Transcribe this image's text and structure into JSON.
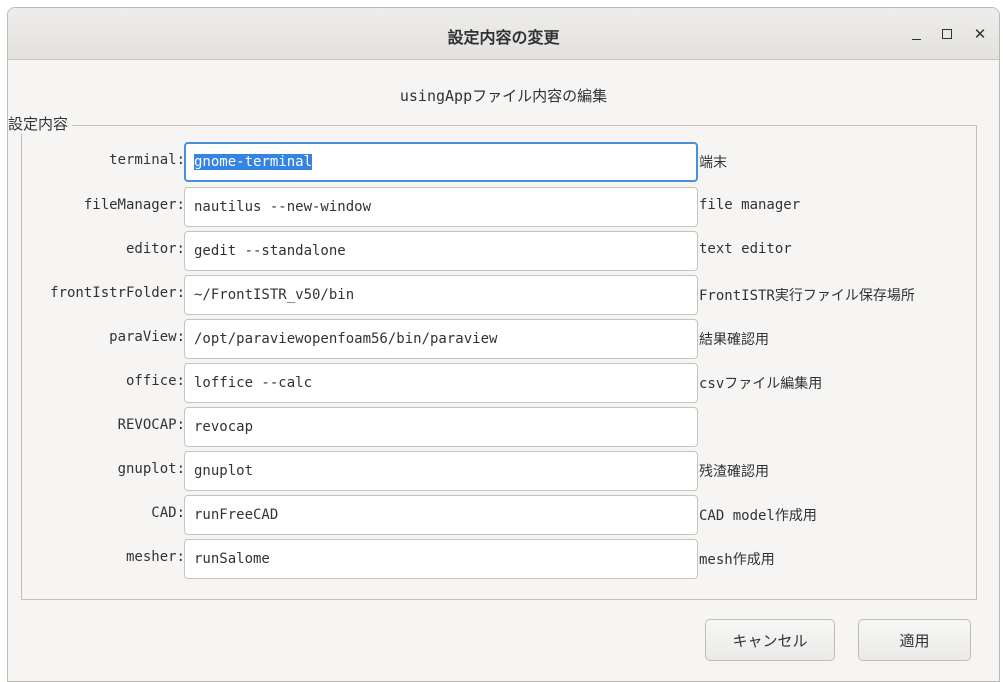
{
  "window": {
    "title": "設定内容の変更",
    "controls": {
      "minimize": "minimize-icon",
      "maximize": "maximize-icon",
      "close": "close-icon"
    }
  },
  "subtitle": "usingAppファイル内容の編集",
  "group": {
    "label": "設定内容"
  },
  "rows": [
    {
      "label": "terminal:",
      "value": "gnome-terminal",
      "desc": "端末"
    },
    {
      "label": "fileManager:",
      "value": "nautilus --new-window",
      "desc": "file manager"
    },
    {
      "label": "editor:",
      "value": "gedit --standalone",
      "desc": "text editor"
    },
    {
      "label": "frontIstrFolder:",
      "value": "~/FrontISTR_v50/bin",
      "desc": "FrontISTR実行ファイル保存場所"
    },
    {
      "label": "paraView:",
      "value": "/opt/paraviewopenfoam56/bin/paraview",
      "desc": "結果確認用"
    },
    {
      "label": "office:",
      "value": "loffice --calc",
      "desc": "csvファイル編集用"
    },
    {
      "label": "REVOCAP:",
      "value": "revocap",
      "desc": ""
    },
    {
      "label": "gnuplot:",
      "value": "gnuplot",
      "desc": "残渣確認用"
    },
    {
      "label": "CAD:",
      "value": "runFreeCAD",
      "desc": "CAD model作成用"
    },
    {
      "label": "mesher:",
      "value": "runSalome",
      "desc": "mesh作成用"
    }
  ],
  "buttons": {
    "cancel": "キャンセル",
    "apply": "適用"
  },
  "colors": {
    "focus": "#4a90d9",
    "selection": "#3584e4"
  }
}
